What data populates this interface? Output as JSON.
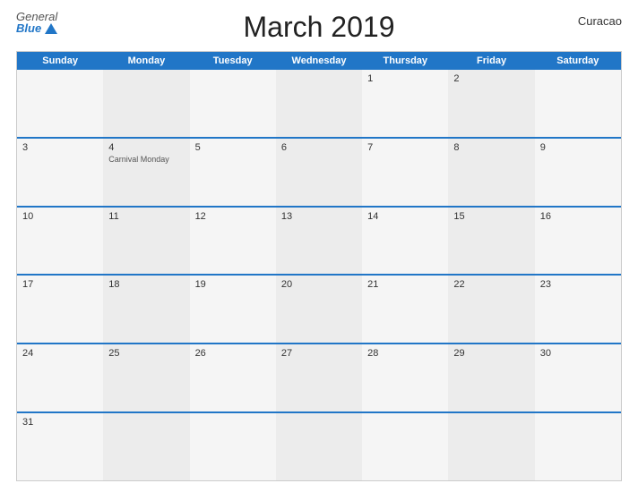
{
  "header": {
    "logo_general": "General",
    "logo_blue": "Blue",
    "title": "March 2019",
    "country": "Curacao"
  },
  "calendar": {
    "days_of_week": [
      "Sunday",
      "Monday",
      "Tuesday",
      "Wednesday",
      "Thursday",
      "Friday",
      "Saturday"
    ],
    "weeks": [
      [
        {
          "day": "",
          "event": ""
        },
        {
          "day": "",
          "event": ""
        },
        {
          "day": "",
          "event": ""
        },
        {
          "day": "",
          "event": ""
        },
        {
          "day": "1",
          "event": ""
        },
        {
          "day": "2",
          "event": ""
        },
        {
          "day": "",
          "event": ""
        }
      ],
      [
        {
          "day": "3",
          "event": ""
        },
        {
          "day": "4",
          "event": "Carnival Monday"
        },
        {
          "day": "5",
          "event": ""
        },
        {
          "day": "6",
          "event": ""
        },
        {
          "day": "7",
          "event": ""
        },
        {
          "day": "8",
          "event": ""
        },
        {
          "day": "9",
          "event": ""
        }
      ],
      [
        {
          "day": "10",
          "event": ""
        },
        {
          "day": "11",
          "event": ""
        },
        {
          "day": "12",
          "event": ""
        },
        {
          "day": "13",
          "event": ""
        },
        {
          "day": "14",
          "event": ""
        },
        {
          "day": "15",
          "event": ""
        },
        {
          "day": "16",
          "event": ""
        }
      ],
      [
        {
          "day": "17",
          "event": ""
        },
        {
          "day": "18",
          "event": ""
        },
        {
          "day": "19",
          "event": ""
        },
        {
          "day": "20",
          "event": ""
        },
        {
          "day": "21",
          "event": ""
        },
        {
          "day": "22",
          "event": ""
        },
        {
          "day": "23",
          "event": ""
        }
      ],
      [
        {
          "day": "24",
          "event": ""
        },
        {
          "day": "25",
          "event": ""
        },
        {
          "day": "26",
          "event": ""
        },
        {
          "day": "27",
          "event": ""
        },
        {
          "day": "28",
          "event": ""
        },
        {
          "day": "29",
          "event": ""
        },
        {
          "day": "30",
          "event": ""
        }
      ],
      [
        {
          "day": "31",
          "event": ""
        },
        {
          "day": "",
          "event": ""
        },
        {
          "day": "",
          "event": ""
        },
        {
          "day": "",
          "event": ""
        },
        {
          "day": "",
          "event": ""
        },
        {
          "day": "",
          "event": ""
        },
        {
          "day": "",
          "event": ""
        }
      ]
    ]
  }
}
